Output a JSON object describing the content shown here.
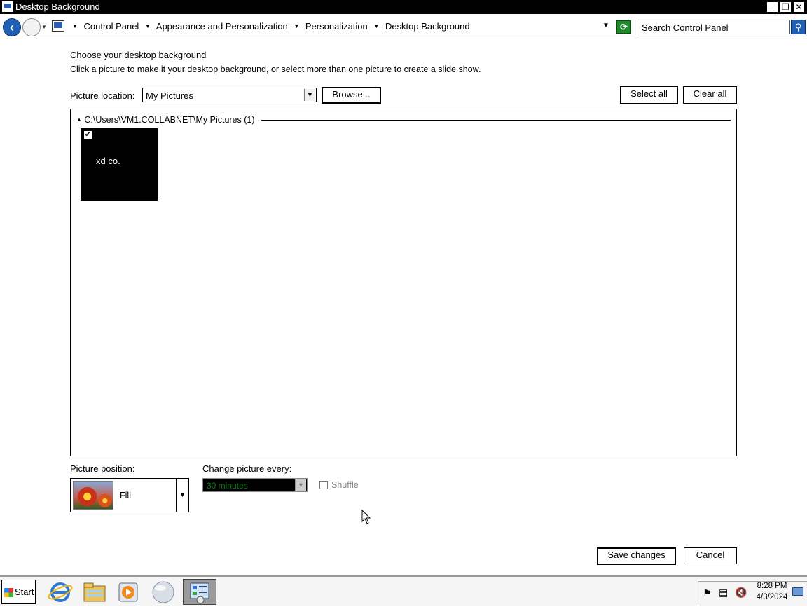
{
  "window": {
    "title": "Desktop Background",
    "controls": {
      "minimize": "_",
      "restore": "❐",
      "close": "✕"
    }
  },
  "address": {
    "breadcrumbs": [
      "Control Panel",
      "Appearance and Personalization",
      "Personalization",
      "Desktop Background"
    ],
    "search_placeholder": "Search Control Panel"
  },
  "main": {
    "heading": "Choose your desktop background",
    "instructions": "Click a picture to make it your desktop background, or select more than one picture to create a slide show.",
    "picture_location_label": "Picture location:",
    "picture_location_value": "My Pictures",
    "browse_label": "Browse...",
    "select_all_label": "Select all",
    "clear_all_label": "Clear all",
    "gallery": {
      "group_header": "C:\\Users\\VM1.COLLABNET\\My Pictures (1)",
      "items": [
        {
          "caption": "xd co.",
          "checked": true
        }
      ]
    },
    "picture_position_label": "Picture position:",
    "picture_position_value": "Fill",
    "change_picture_label": "Change picture every:",
    "change_picture_value": "30 minutes",
    "shuffle_label": "Shuffle",
    "shuffle_checked": false
  },
  "footer": {
    "save_label": "Save changes",
    "cancel_label": "Cancel"
  },
  "taskbar": {
    "start_label": "Start",
    "pinned": [
      "internet-explorer-icon",
      "file-explorer-icon",
      "media-player-icon",
      "orb-app-icon",
      "control-panel-icon"
    ],
    "clock_time": "8:28 PM",
    "clock_date": "4/3/2024"
  },
  "colors": {
    "accent": "#1f5fb4",
    "interval_text": "#0f7a19",
    "titlebar": "#000000"
  }
}
